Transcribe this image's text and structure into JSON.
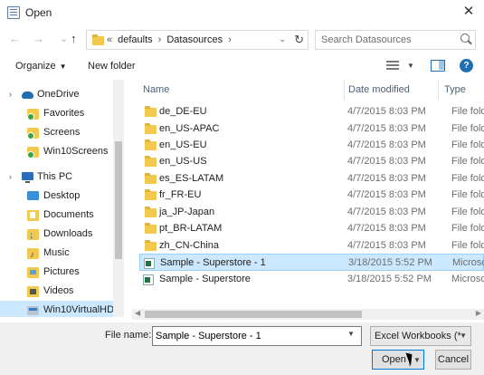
{
  "window": {
    "title": "Open",
    "close_glyph": "✕"
  },
  "nav": {
    "back": "←",
    "forward": "→",
    "up": "↑"
  },
  "address": {
    "overflow": "«",
    "segments": [
      "defaults",
      "Datasources"
    ],
    "separator": "›",
    "dropdown": "⌄",
    "refresh": "↻"
  },
  "search": {
    "placeholder": "Search Datasources"
  },
  "toolbar": {
    "organize": "Organize",
    "organize_caret": "▼",
    "new_folder": "New folder",
    "view_caret": "▼",
    "help": "?"
  },
  "sidebar": {
    "items": [
      {
        "label": "OneDrive",
        "icon": "cloud-icon"
      },
      {
        "label": "Favorites",
        "icon": "favorites-folder-icon"
      },
      {
        "label": "Screens",
        "icon": "screens-folder-icon"
      },
      {
        "label": "Win10Screens",
        "icon": "win10screens-folder-icon"
      },
      {
        "label": "This PC",
        "icon": "computer-icon"
      },
      {
        "label": "Desktop",
        "icon": "desktop-icon"
      },
      {
        "label": "Documents",
        "icon": "documents-icon"
      },
      {
        "label": "Downloads",
        "icon": "downloads-icon"
      },
      {
        "label": "Music",
        "icon": "music-icon"
      },
      {
        "label": "Pictures",
        "icon": "pictures-icon"
      },
      {
        "label": "Videos",
        "icon": "videos-icon"
      },
      {
        "label": "Win10VirtualHD",
        "icon": "drive-icon"
      }
    ]
  },
  "files": {
    "columns": {
      "name": "Name",
      "date": "Date modified",
      "type": "Type"
    },
    "rows": [
      {
        "name": "de_DE-EU",
        "date": "4/7/2015 8:03 PM",
        "type": "File folder",
        "kind": "folder"
      },
      {
        "name": "en_US-APAC",
        "date": "4/7/2015 8:03 PM",
        "type": "File folder",
        "kind": "folder"
      },
      {
        "name": "en_US-EU",
        "date": "4/7/2015 8:03 PM",
        "type": "File folder",
        "kind": "folder"
      },
      {
        "name": "en_US-US",
        "date": "4/7/2015 8:03 PM",
        "type": "File folder",
        "kind": "folder"
      },
      {
        "name": "es_ES-LATAM",
        "date": "4/7/2015 8:03 PM",
        "type": "File folder",
        "kind": "folder"
      },
      {
        "name": "fr_FR-EU",
        "date": "4/7/2015 8:03 PM",
        "type": "File folder",
        "kind": "folder"
      },
      {
        "name": "ja_JP-Japan",
        "date": "4/7/2015 8:03 PM",
        "type": "File folder",
        "kind": "folder"
      },
      {
        "name": "pt_BR-LATAM",
        "date": "4/7/2015 8:03 PM",
        "type": "File folder",
        "kind": "folder"
      },
      {
        "name": "zh_CN-China",
        "date": "4/7/2015 8:03 PM",
        "type": "File folder",
        "kind": "folder"
      },
      {
        "name": "Sample - Superstore - 1",
        "date": "3/18/2015 5:52 PM",
        "type": "Microsoft",
        "kind": "excel"
      },
      {
        "name": "Sample - Superstore",
        "date": "3/18/2015 5:52 PM",
        "type": "Microsoft",
        "kind": "excel"
      }
    ]
  },
  "footer": {
    "file_name_label": "File name:",
    "file_name_value": "Sample - Superstore - 1",
    "filter": "Excel Workbooks (*",
    "open": "Open",
    "cancel": "Cancel",
    "caret": "▼"
  },
  "colors": {
    "selection": "#cce8ff",
    "accent": "#0078d7",
    "folder": "#f2c94c"
  }
}
